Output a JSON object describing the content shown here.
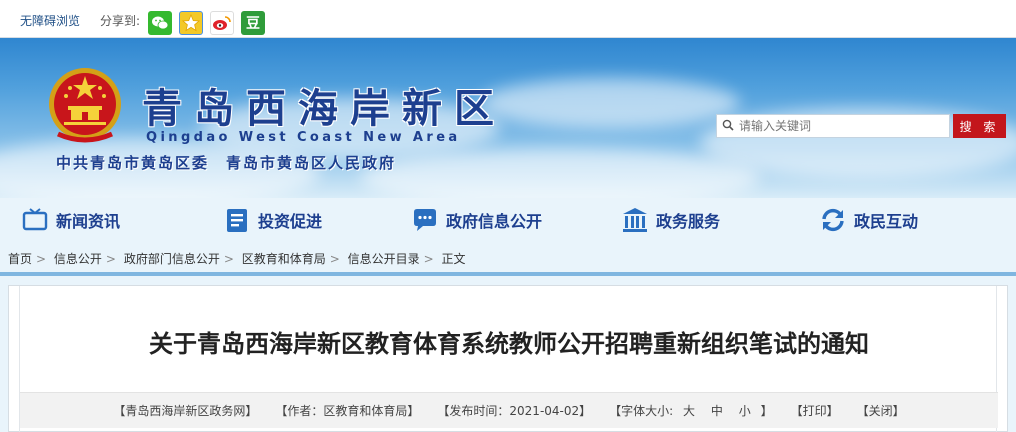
{
  "topbar": {
    "accessibility": "无障碍浏览",
    "share_label": "分享到:",
    "share_icons": [
      {
        "name": "wechat-icon",
        "glyph": "✉"
      },
      {
        "name": "qzone-icon",
        "glyph": "★"
      },
      {
        "name": "weibo-icon",
        "glyph": "◎"
      },
      {
        "name": "douban-icon",
        "glyph": "豆"
      }
    ]
  },
  "header": {
    "title": "青岛西海岸新区",
    "subtitle": "Qingdao West Coast New Area",
    "org": "中共青岛市黄岛区委　青岛市黄岛区人民政府",
    "search_placeholder": "请输入关键词",
    "search_button": "搜 索"
  },
  "nav": [
    {
      "label": "新闻资讯",
      "icon": "tv-icon"
    },
    {
      "label": "投资促进",
      "icon": "document-list-icon"
    },
    {
      "label": "政府信息公开",
      "icon": "chat-bubble-icon"
    },
    {
      "label": "政务服务",
      "icon": "building-icon"
    },
    {
      "label": "政民互动",
      "icon": "refresh-icon"
    }
  ],
  "breadcrumb": [
    "首页",
    "信息公开",
    "政府部门信息公开",
    "区教育和体育局",
    "信息公开目录",
    "正文"
  ],
  "article": {
    "title": "关于青岛西海岸新区教育体育系统教师公开招聘重新组织笔试的通知",
    "source": "【青岛西海岸新区政务网】",
    "author": "【作者：区教育和体育局】",
    "date": "【发布时间：2021-04-02】",
    "font_size_label": "【字体大小:",
    "font_sizes": [
      "大",
      "中",
      "小"
    ],
    "font_size_close": "】",
    "print": "【打印】",
    "close": "【关闭】"
  },
  "colors": {
    "brand_blue": "#1d3f8f",
    "search_red": "#c3161c"
  }
}
